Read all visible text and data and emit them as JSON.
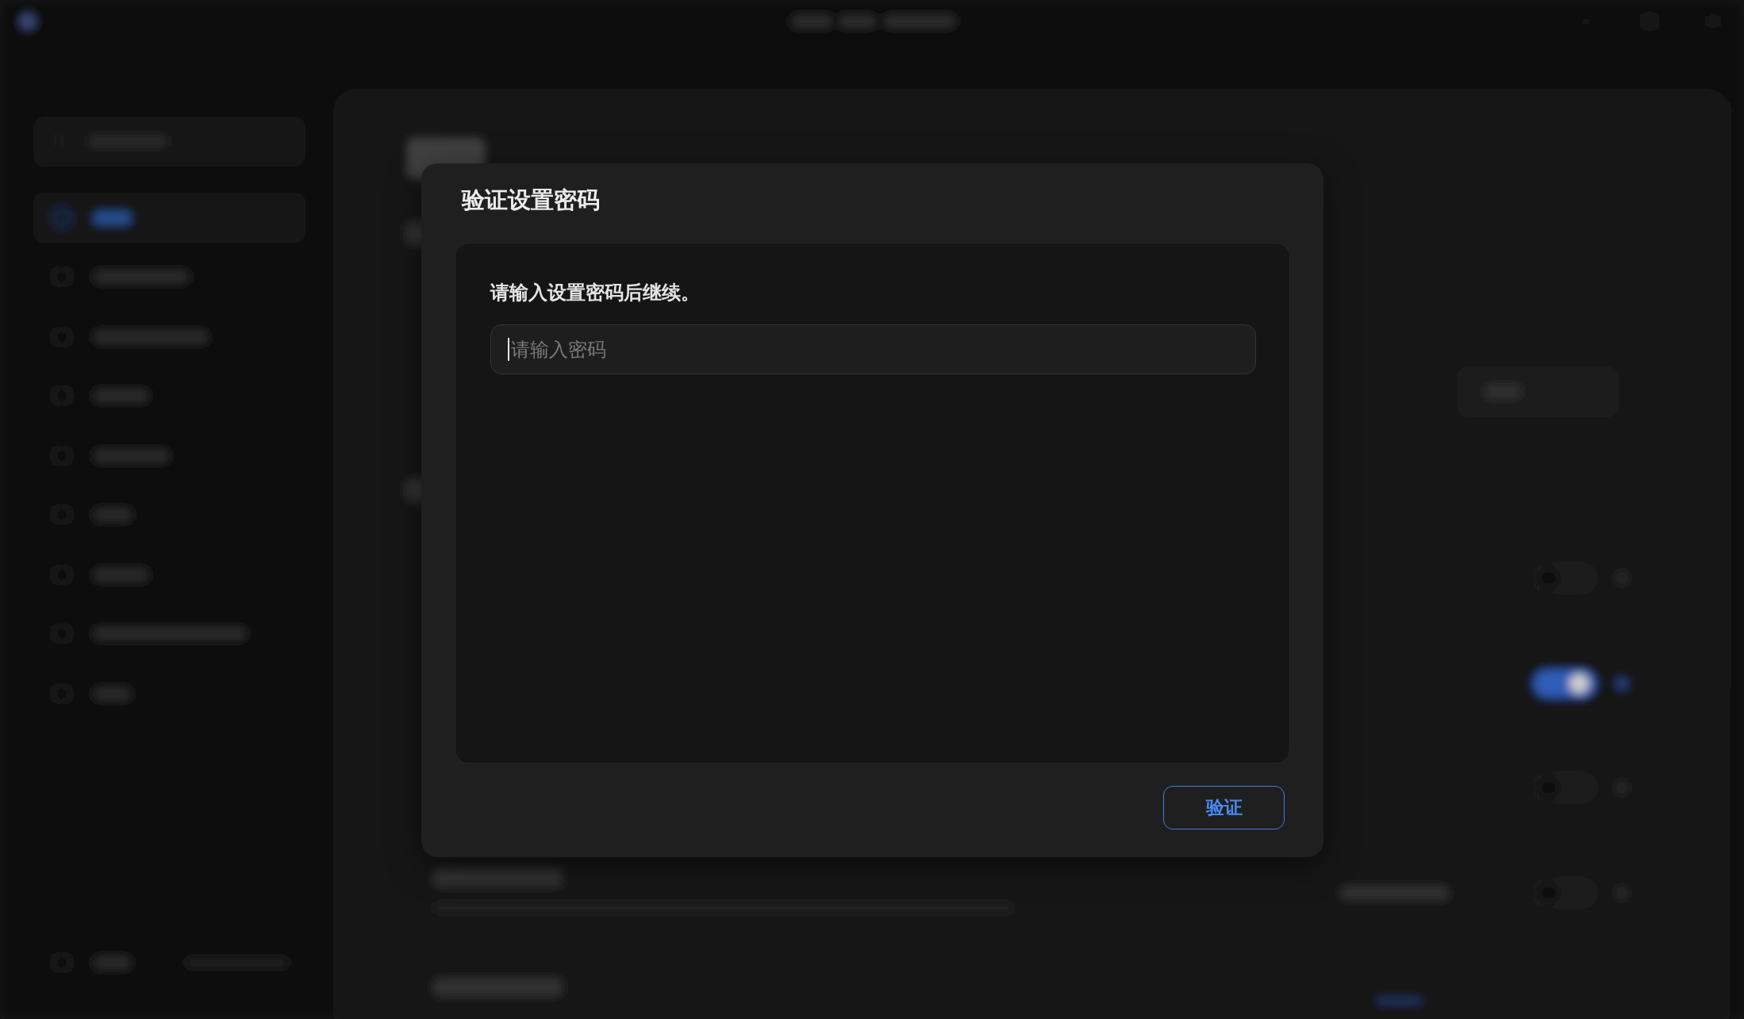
{
  "dialog": {
    "title": "验证设置密码",
    "message": "请输入设置密码后继续。",
    "password_field": {
      "placeholder": "请输入密码",
      "focused": true
    },
    "buttons": [
      {
        "label": "验证",
        "kind": "outline"
      }
    ]
  }
}
